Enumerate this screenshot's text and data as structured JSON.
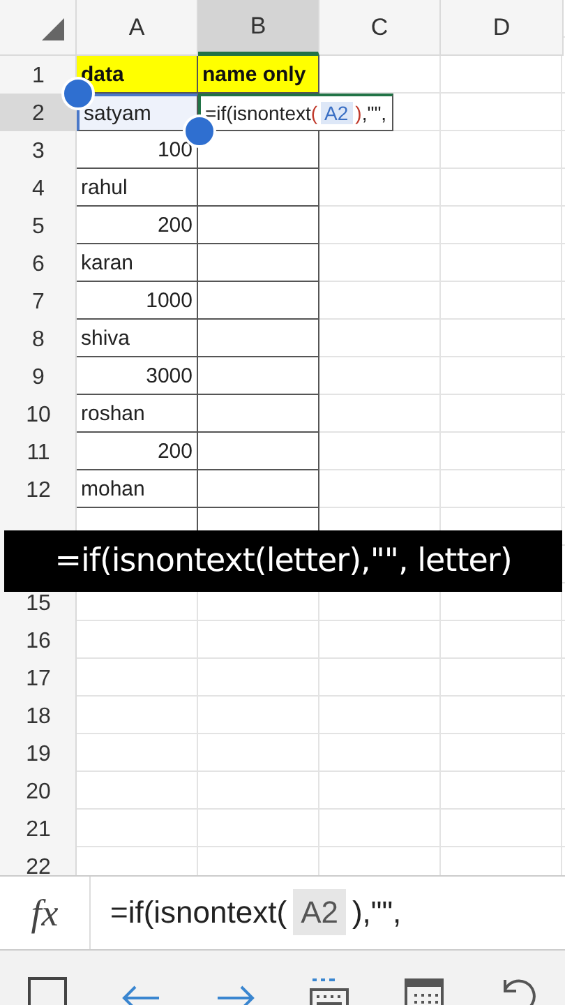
{
  "columns": [
    {
      "label": "A",
      "selected": false
    },
    {
      "label": "B",
      "selected": true
    },
    {
      "label": "C",
      "selected": false
    },
    {
      "label": "D",
      "selected": false
    }
  ],
  "rows": [
    {
      "number": "1",
      "selected": false,
      "boxed": true,
      "cells": [
        {
          "kind": "header",
          "text": "data"
        },
        {
          "kind": "header",
          "text": "name only"
        }
      ]
    },
    {
      "number": "2",
      "selected": true,
      "boxed": true,
      "cells": [
        {
          "kind": "reference",
          "text": "satyam"
        },
        {
          "kind": "editing",
          "parts": [
            {
              "kind": "plain",
              "text": "=if(isnontext"
            },
            {
              "kind": "paren",
              "text": "("
            },
            {
              "kind": "ref",
              "text": "A2"
            },
            {
              "kind": "paren",
              "text": ")"
            },
            {
              "kind": "plain",
              "text": ",\"\","
            }
          ]
        }
      ]
    },
    {
      "number": "3",
      "selected": false,
      "boxed": true,
      "cells": [
        {
          "kind": "number",
          "text": "100"
        }
      ]
    },
    {
      "number": "4",
      "selected": false,
      "boxed": true,
      "cells": [
        {
          "kind": "text",
          "text": "rahul"
        }
      ]
    },
    {
      "number": "5",
      "selected": false,
      "boxed": true,
      "cells": [
        {
          "kind": "number",
          "text": "200"
        }
      ]
    },
    {
      "number": "6",
      "selected": false,
      "boxed": true,
      "cells": [
        {
          "kind": "text",
          "text": "karan"
        }
      ]
    },
    {
      "number": "7",
      "selected": false,
      "boxed": true,
      "cells": [
        {
          "kind": "number",
          "text": "1000"
        }
      ]
    },
    {
      "number": "8",
      "selected": false,
      "boxed": true,
      "cells": [
        {
          "kind": "text",
          "text": "shiva"
        }
      ]
    },
    {
      "number": "9",
      "selected": false,
      "boxed": true,
      "cells": [
        {
          "kind": "number",
          "text": "3000"
        }
      ]
    },
    {
      "number": "10",
      "selected": false,
      "boxed": true,
      "cells": [
        {
          "kind": "text",
          "text": "roshan"
        }
      ]
    },
    {
      "number": "11",
      "selected": false,
      "boxed": true,
      "cells": [
        {
          "kind": "number",
          "text": "200"
        }
      ]
    },
    {
      "number": "12",
      "selected": false,
      "boxed": true,
      "cells": [
        {
          "kind": "text",
          "text": "mohan"
        }
      ]
    },
    {
      "boxed": true
    },
    {},
    {
      "number": "15",
      "selected": false,
      "boxed": false
    },
    {
      "number": "16",
      "selected": false,
      "boxed": false
    },
    {
      "number": "17",
      "selected": false,
      "boxed": false
    },
    {
      "number": "18",
      "selected": false,
      "boxed": false
    },
    {
      "number": "19",
      "selected": false,
      "boxed": false
    },
    {
      "number": "20",
      "selected": false,
      "boxed": false
    },
    {
      "number": "21",
      "selected": false,
      "boxed": false
    },
    {
      "number": "22",
      "selected": false,
      "boxed": false
    }
  ],
  "caption": "=if(isnontext(letter),\"\", letter)",
  "formula_bar": {
    "label": "fx",
    "parts": [
      {
        "kind": "plain",
        "text": "=if(isnontext("
      },
      {
        "kind": "ref",
        "text": "A2"
      },
      {
        "kind": "plain",
        "text": "),\"\","
      }
    ]
  }
}
